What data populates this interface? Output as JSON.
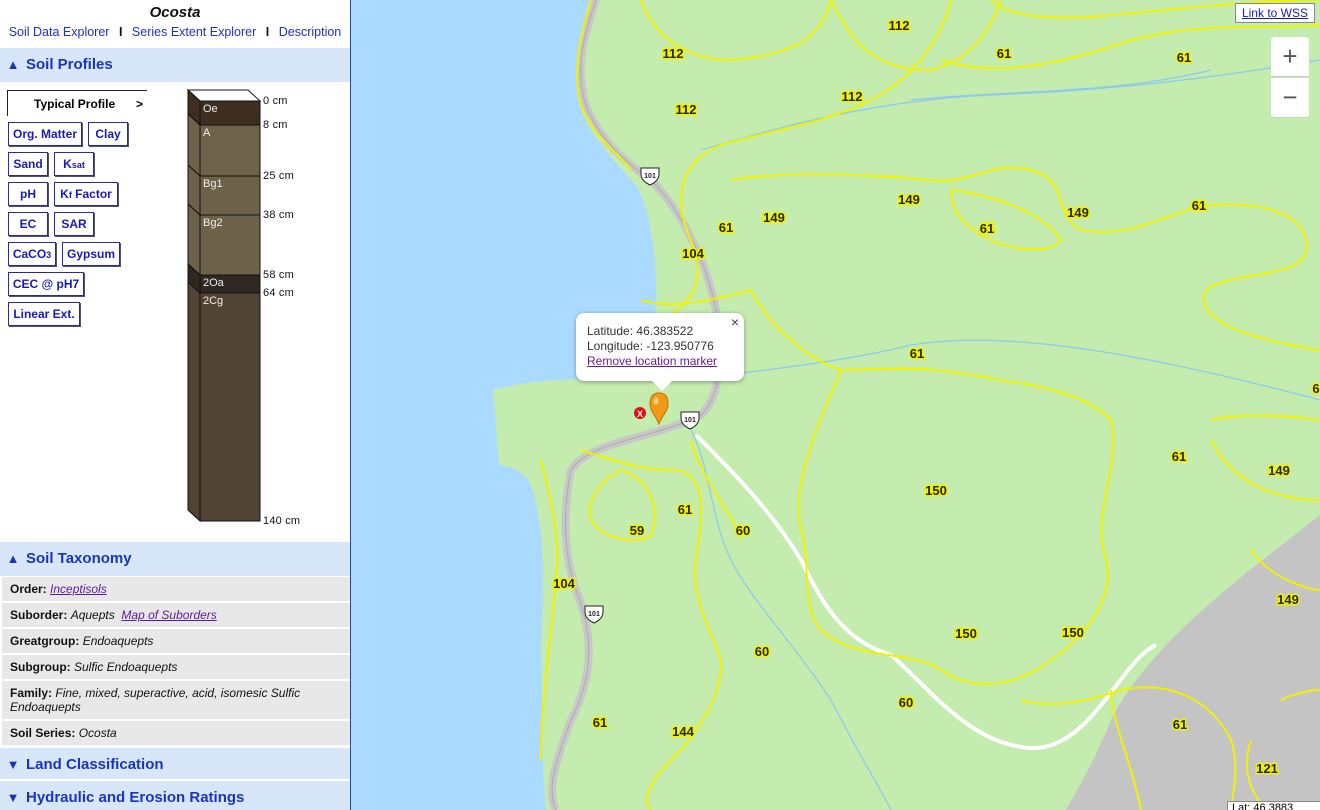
{
  "sidebar": {
    "title": "Ocosta",
    "nav": [
      "Soil Data Explorer",
      "Series Extent Explorer",
      "Description"
    ],
    "nav_sep": "I",
    "profiles_header": "Soil Profiles",
    "profile_tab": "Typical Profile",
    "profile_tab_arrow": ">",
    "buttons": {
      "org_matter": "Org. Matter",
      "clay": "Clay",
      "sand": "Sand",
      "ksat_k": "K",
      "ksat_sub": "sat",
      "ph": "pH",
      "kf_k": "K",
      "kf_sub": "f",
      "kf_rest": " Factor",
      "ec": "EC",
      "sar": "SAR",
      "caco3_main": "CaCO",
      "caco3_sub": "3",
      "gypsum": "Gypsum",
      "cec": "CEC @ pH7",
      "linear_ext": "Linear Ext."
    },
    "horizons": [
      {
        "name": "Oe",
        "top_cm": 0,
        "bottom_cm": 8,
        "color": "#3e2d21"
      },
      {
        "name": "A",
        "top_cm": 8,
        "bottom_cm": 25,
        "color": "#6f624b"
      },
      {
        "name": "Bg1",
        "top_cm": 25,
        "bottom_cm": 38,
        "color": "#6e6149"
      },
      {
        "name": "Bg2",
        "top_cm": 38,
        "bottom_cm": 58,
        "color": "#6e6149"
      },
      {
        "name": "2Oa",
        "top_cm": 58,
        "bottom_cm": 64,
        "color": "#2f2822"
      },
      {
        "name": "2Cg",
        "top_cm": 64,
        "bottom_cm": 140,
        "color": "#514435"
      }
    ],
    "depth_labels": [
      "0 cm",
      "8 cm",
      "25 cm",
      "38 cm",
      "58 cm",
      "64 cm",
      "140 cm"
    ],
    "taxonomy_header": "Soil Taxonomy",
    "taxonomy": {
      "order_label": "Order:",
      "order_value": "Inceptisols",
      "suborder_label": "Suborder:",
      "suborder_value": "Aquepts",
      "suborder_link": "Map of Suborders",
      "greatgroup_label": "Greatgroup:",
      "greatgroup_value": "Endoaquepts",
      "subgroup_label": "Subgroup:",
      "subgroup_value": "Sulfic Endoaquepts",
      "family_label": "Family:",
      "family_value": "Fine, mixed, superactive, acid, isomesic Sulfic Endoaquepts",
      "series_label": "Soil Series:",
      "series_value": "Ocosta"
    },
    "land_header": "Land Classification",
    "hydraulic_header": "Hydraulic and Erosion Ratings"
  },
  "map": {
    "link_wss": "Link to WSS",
    "zoom_in": "+",
    "zoom_out": "−",
    "popup": {
      "lat_label": "Latitude:",
      "lat": "46.383522",
      "lon_label": "Longitude:",
      "lon": "-123.950776",
      "remove": "Remove location marker",
      "close": "×"
    },
    "marker_x": "X",
    "route_shield": "101",
    "labels": [
      "112",
      "112",
      "112",
      "112",
      "61",
      "61",
      "61",
      "61",
      "61",
      "61",
      "149",
      "149",
      "149",
      "149",
      "149",
      "104",
      "104",
      "150",
      "150",
      "150",
      "59",
      "60",
      "60",
      "60",
      "61",
      "144",
      "61",
      "121",
      "61",
      "61",
      "61",
      "6"
    ],
    "coord_box": "Lat: 46.3883"
  },
  "colors": {
    "water": "#aadaff",
    "land": "#c3ecae",
    "soil_line": "#f2f200",
    "road": "#c8c8c8",
    "urban": "#c4c4c4",
    "header_bg": "#d8e6fa",
    "header_text": "#1a36b8"
  }
}
